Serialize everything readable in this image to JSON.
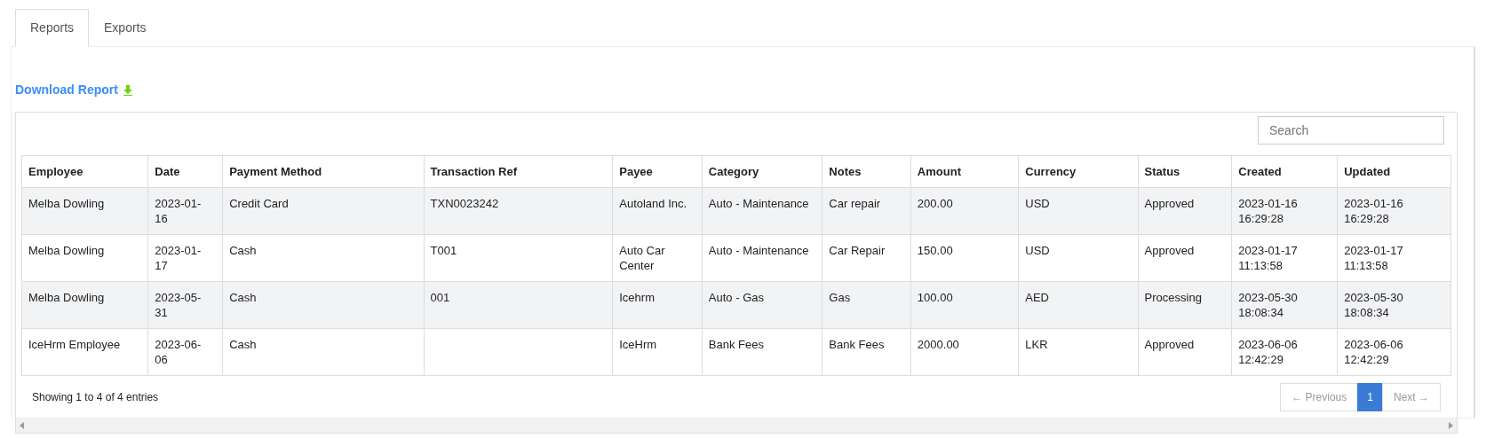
{
  "tabs": [
    {
      "label": "Reports",
      "selected": true
    },
    {
      "label": "Exports",
      "selected": false
    }
  ],
  "download_link": {
    "label": "Download Report"
  },
  "search": {
    "placeholder": "Search"
  },
  "table": {
    "columns": [
      "Employee",
      "Date",
      "Payment Method",
      "Transaction Ref",
      "Payee",
      "Category",
      "Notes",
      "Amount",
      "Currency",
      "Status",
      "Created",
      "Updated"
    ],
    "rows": [
      [
        "Melba Dowling",
        "2023-01-16",
        "Credit Card",
        "TXN0023242",
        "Autoland Inc.",
        "Auto - Maintenance",
        "Car repair",
        "200.00",
        "USD",
        "Approved",
        "2023-01-16 16:29:28",
        "2023-01-16 16:29:28"
      ],
      [
        "Melba Dowling",
        "2023-01-17",
        "Cash",
        "T001",
        "Auto Car Center",
        "Auto - Maintenance",
        "Car Repair",
        "150.00",
        "USD",
        "Approved",
        "2023-01-17 11:13:58",
        "2023-01-17 11:13:58"
      ],
      [
        "Melba Dowling",
        "2023-05-31",
        "Cash",
        "001",
        "Icehrm",
        "Auto - Gas",
        "Gas",
        "100.00",
        "AED",
        "Processing",
        "2023-05-30 18:08:34",
        "2023-05-30 18:08:34"
      ],
      [
        "IceHrm Employee",
        "2023-06-06",
        "Cash",
        "",
        "IceHrm",
        "Bank Fees",
        "Bank Fees",
        "2000.00",
        "LKR",
        "Approved",
        "2023-06-06 12:42:29",
        "2023-06-06 12:42:29"
      ]
    ]
  },
  "info": "Showing 1 to 4 of 4 entries",
  "pagination": [
    {
      "label": "← Previous",
      "kind": "prev",
      "disabled": true,
      "selected": false
    },
    {
      "label": "1",
      "kind": "page",
      "disabled": false,
      "selected": true
    },
    {
      "label": "Next →",
      "kind": "next",
      "disabled": true,
      "selected": false
    }
  ]
}
